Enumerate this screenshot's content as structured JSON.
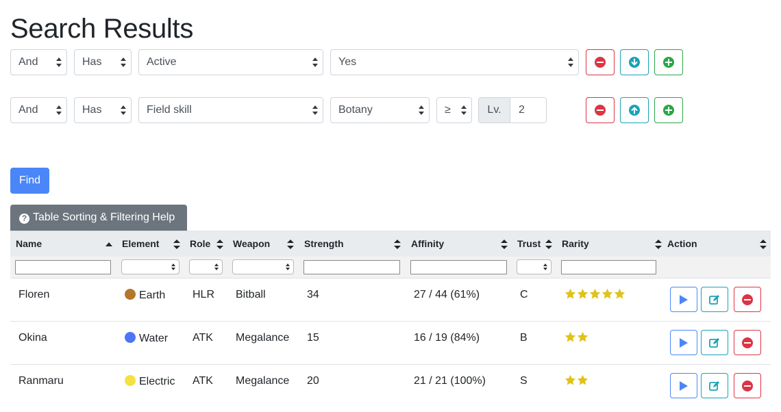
{
  "page": {
    "title": "Search Results"
  },
  "filters": [
    {
      "logic": "And",
      "mode": "Has",
      "field": "Active",
      "value": "Yes",
      "move_icon": "arrow-down-circle-icon"
    },
    {
      "logic": "And",
      "mode": "Has",
      "field": "Field skill",
      "value": "Botany",
      "operator": "≥",
      "level_label": "Lv.",
      "level_value": "2",
      "move_icon": "arrow-up-circle-icon"
    }
  ],
  "buttons": {
    "find": "Find",
    "help": "Table Sorting & Filtering Help"
  },
  "table": {
    "headers": [
      "Name",
      "Element",
      "Role",
      "Weapon",
      "Strength",
      "Affinity",
      "Trust",
      "Rarity",
      "Action"
    ],
    "sorted_column": "Name",
    "rows": [
      {
        "name": "Floren",
        "element": "Earth",
        "element_color": "#b5762a",
        "role": "HLR",
        "weapon": "Bitball",
        "strength": "34",
        "affinity": "27 / 44 (61%)",
        "trust": "C",
        "rarity": 5
      },
      {
        "name": "Okina",
        "element": "Water",
        "element_color": "#4f74f7",
        "role": "ATK",
        "weapon": "Megalance",
        "strength": "15",
        "affinity": "16 / 19 (84%)",
        "trust": "B",
        "rarity": 2
      },
      {
        "name": "Ranmaru",
        "element": "Electric",
        "element_color": "#f5e13f",
        "role": "ATK",
        "weapon": "Megalance",
        "strength": "20",
        "affinity": "21 / 21 (100%)",
        "trust": "S",
        "rarity": 2
      }
    ],
    "star_color": "#e0c21b",
    "action_icons": [
      "play-icon",
      "edit-icon",
      "delete-icon"
    ]
  },
  "colors": {
    "primary": "#4a86f7",
    "danger": "#dc3545",
    "info": "#17a2b8",
    "success": "#28a745",
    "secondary": "#6c757d"
  }
}
